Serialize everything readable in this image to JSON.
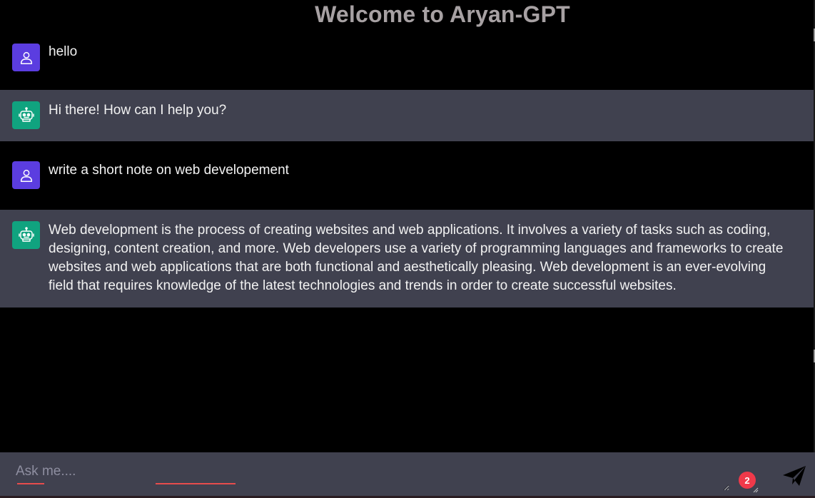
{
  "header": {
    "title": "Welcome to Aryan-GPT"
  },
  "messages": [
    {
      "role": "user",
      "avatar_icon": "user-icon",
      "text": "hello"
    },
    {
      "role": "bot",
      "avatar_icon": "robot-icon",
      "text": " Hi there! How can I help you?"
    },
    {
      "role": "user",
      "avatar_icon": "user-icon",
      "text": "write a short note on web developement"
    },
    {
      "role": "bot",
      "avatar_icon": "robot-icon",
      "text": " Web development is the process of creating websites and web applications. It involves a variety of tasks such as coding, designing, content creation, and more. Web developers use a variety of programming languages and frameworks to create websites and web applications that are both functional and aesthetically pleasing. Web development is an ever-evolving field that requires knowledge of the latest technologies and trends in order to create successful websites."
    }
  ],
  "composer": {
    "placeholder": "Ask me....",
    "value": "",
    "badge_count": "2",
    "send_icon": "send-icon"
  },
  "colors": {
    "background": "#000000",
    "bot_row": "#40414f",
    "user_avatar": "#5b3de0",
    "bot_avatar": "#10a37f",
    "title": "#a7a1a3",
    "badge": "#f0394a"
  }
}
